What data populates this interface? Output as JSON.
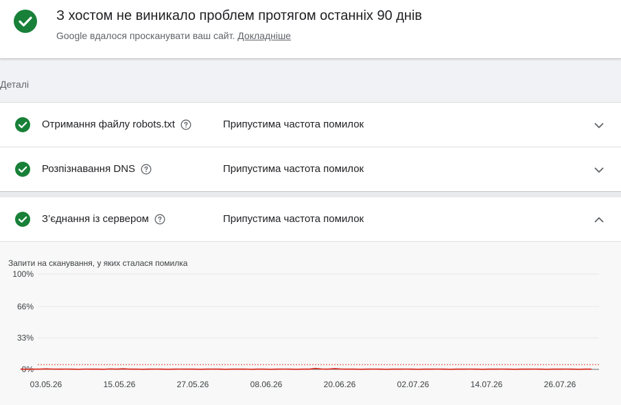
{
  "header": {
    "title": "З хостом не виникало проблем протягом останніх 90 днів",
    "subtitle": "Google вдалося просканувати ваш сайт.",
    "link": "Докладніше"
  },
  "details": {
    "label": "Деталі"
  },
  "rows": [
    {
      "title": "Отримання файлу robots.txt",
      "status": "Припустима частота помилок",
      "expanded": false
    },
    {
      "title": "Розпізнавання DNS",
      "status": "Припустима частота помилок",
      "expanded": false
    },
    {
      "title": "З’єднання із сервером",
      "status": "Припустима частота помилок",
      "expanded": true
    }
  ],
  "colors": {
    "success": "#188038",
    "error_line": "#d93025",
    "threshold": "#e57368"
  },
  "chart_data": {
    "type": "line",
    "title": "Запити на сканування, у яких сталася помилка",
    "ylabel": "",
    "xlabel": "",
    "ylim": [
      0,
      100
    ],
    "y_ticks": [
      "100%",
      "66%",
      "33%",
      "0%"
    ],
    "y_tick_values": [
      100,
      66,
      33,
      0
    ],
    "x_ticks": [
      "03.05.26",
      "15.05.26",
      "27.05.26",
      "08.06.26",
      "20.06.26",
      "02.07.26",
      "14.07.26",
      "26.07.26"
    ],
    "threshold": 5,
    "series": [
      {
        "values": [
          0.2,
          0.1,
          0.3,
          0.2,
          0.5,
          0.3,
          0.2,
          0.3,
          0.2,
          0.1,
          0.3,
          0.2,
          0.2,
          0.1,
          0.4,
          0.2,
          0.6,
          0.2,
          0.3,
          0.1,
          0.2,
          0.3,
          0.2,
          0.1,
          0.2,
          0.3,
          0.2,
          0.2,
          0.1,
          0.2,
          0.3,
          0.2,
          0.1,
          0.2,
          0.2,
          0.3,
          0.1,
          0.2,
          0.2,
          0.1,
          0.2,
          0.3,
          0.2,
          0.1,
          0.2,
          0.2,
          1.0,
          0.3,
          0.2,
          0.8,
          0.3,
          0.2,
          0.2,
          0.1,
          0.2,
          0.3,
          0.2,
          0.1,
          0.2,
          0.2,
          0.3,
          0.2,
          0.1,
          0.2,
          0.2,
          0.3,
          0.2,
          0.1,
          0.2,
          0.2,
          0.3,
          0.2,
          0.1,
          0.2,
          0.2,
          0.3,
          0.2,
          0.1,
          0.2,
          0.2,
          0.3,
          0.2,
          0.1,
          0.2,
          0.2,
          0.3,
          0.2,
          0.1,
          0.2,
          0.2
        ]
      }
    ]
  }
}
